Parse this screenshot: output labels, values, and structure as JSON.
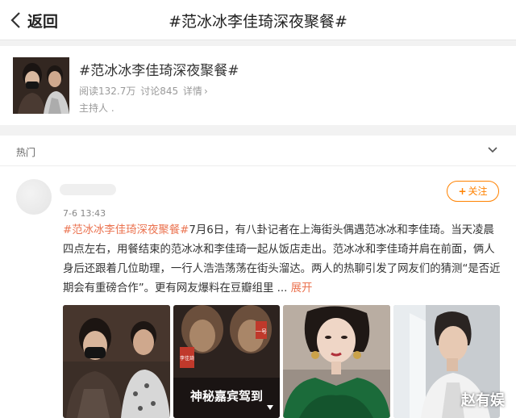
{
  "header": {
    "back_label": "返回",
    "title": "#范冰冰李佳琦深夜聚餐#"
  },
  "topic": {
    "title": "#范冰冰李佳琦深夜聚餐#",
    "reads": "阅读132.7万",
    "discussions": "讨论845",
    "details": "详情",
    "details_arrow": "›",
    "host": "主持人 ."
  },
  "feed": {
    "section_label": "热门"
  },
  "post": {
    "time": "7-6 13:43",
    "follow_label": "关注",
    "follow_plus": "+",
    "hashtag": "#范冰冰李佳琦深夜聚餐#",
    "body": "7月6日，有八卦记者在上海街头偶遇范冰冰和李佳琦。当天凌晨四点左右，用餐结束的范冰冰和李佳琦一起从饭店走出。范冰冰和李佳琦并肩在前面，俩人身后还跟着几位助理，一行人浩浩荡荡在街头溜达。两人的热聊引发了网友们的猜测“是否近期会有重磅合作”。更有网友爆料在豆瓣组里 ...",
    "expand_label": "展开",
    "photo_caption": "神秘嘉宾驾到",
    "photo_tag_1": "一号",
    "photo_tag_2": "李佳琦"
  },
  "watermark": "赵有娱",
  "colors": {
    "accent": "#ff8200",
    "link": "#eb7350",
    "text": "#333333",
    "muted": "#9a9a9a"
  },
  "icons": {
    "back": "chevron-left-icon",
    "collapse": "chevron-down-icon"
  }
}
